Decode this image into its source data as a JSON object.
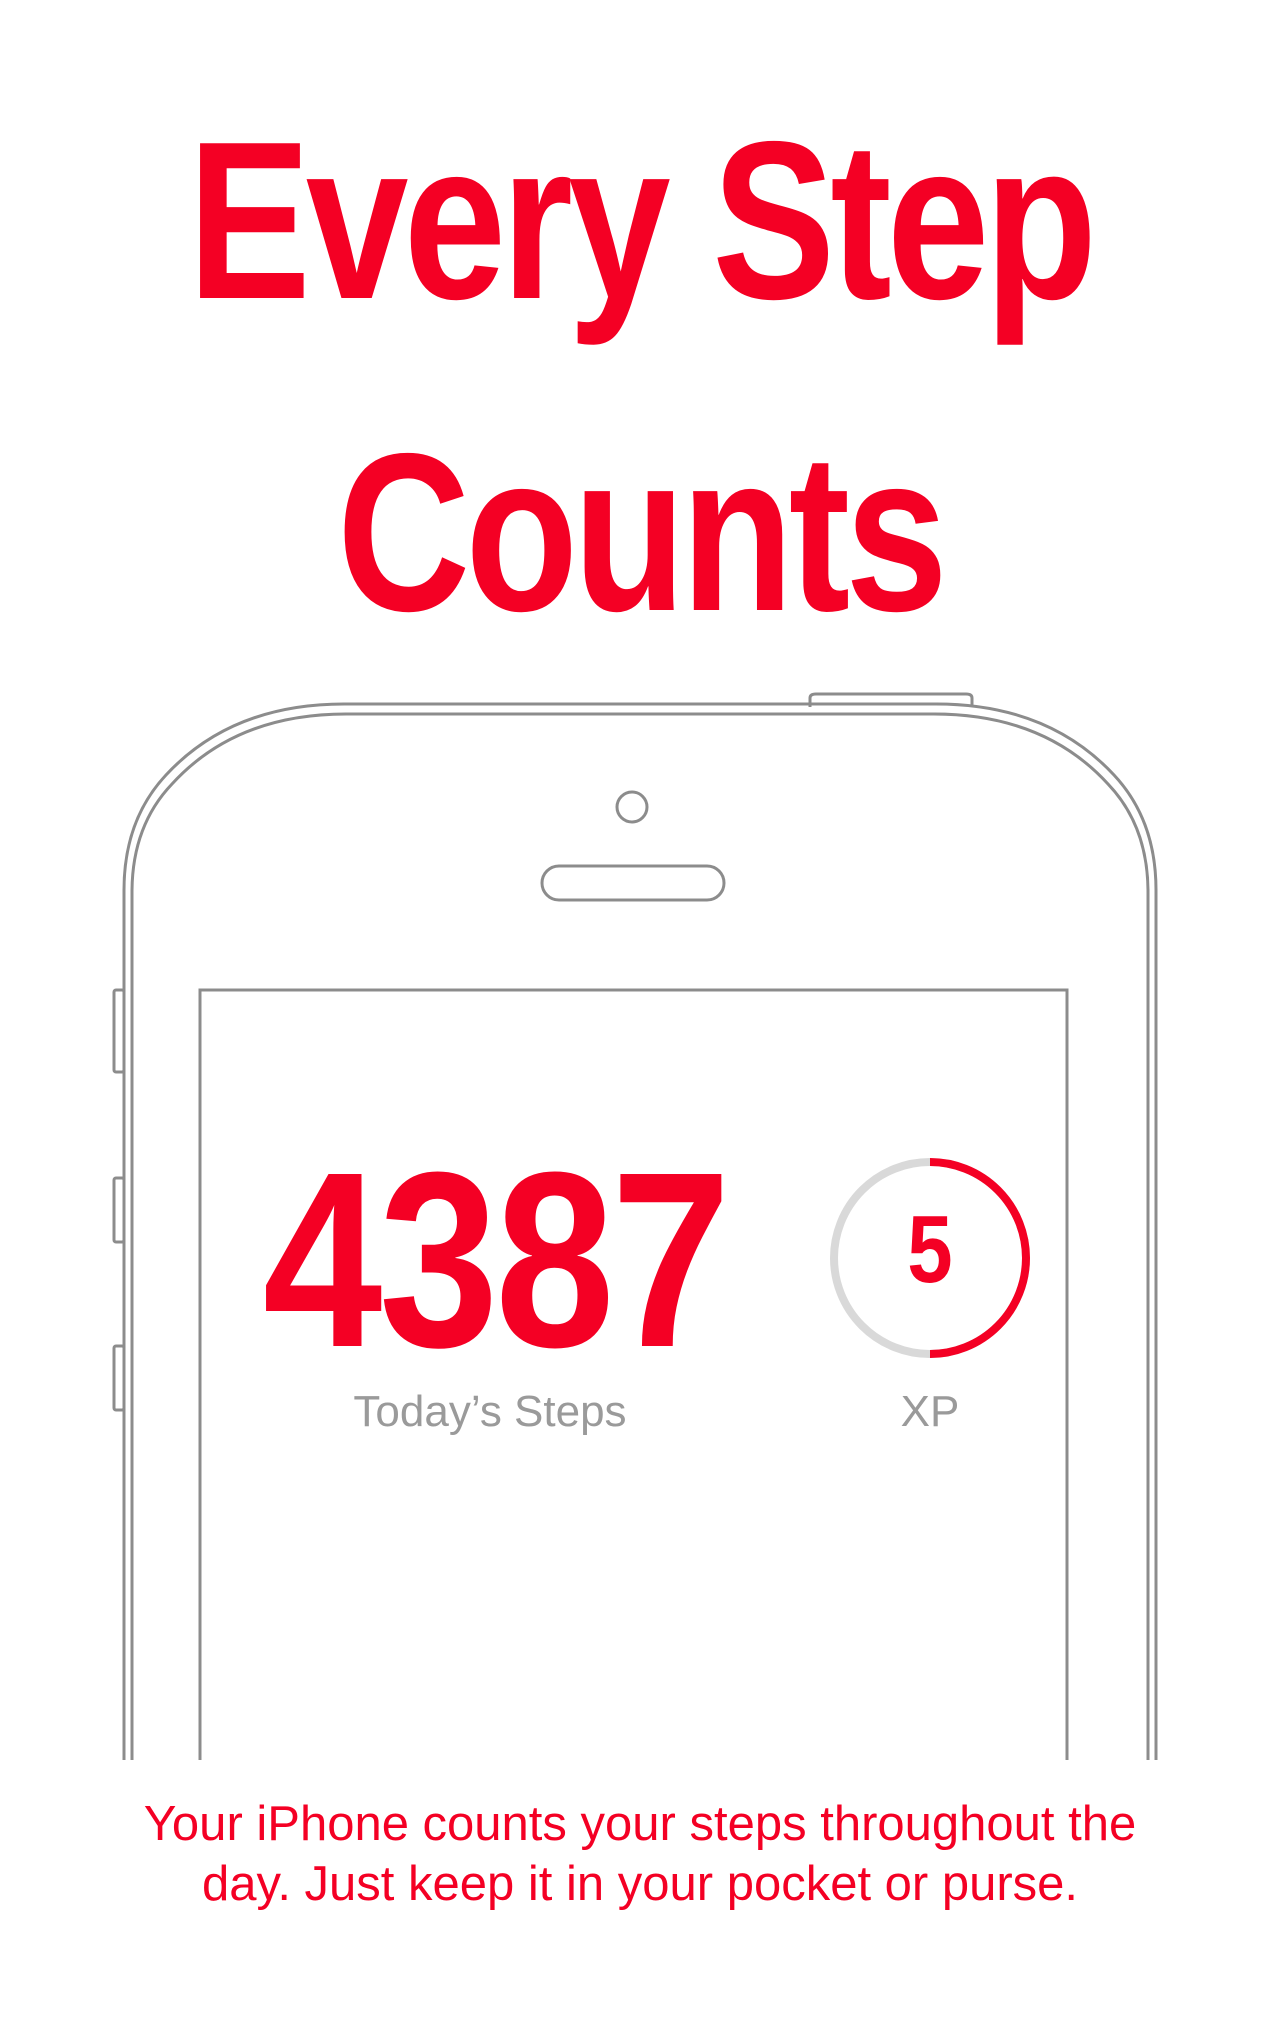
{
  "headline": {
    "line1": "Every Step",
    "line2": "Counts"
  },
  "screen": {
    "steps_value": "4387",
    "steps_label": "Today’s Steps",
    "xp_value": "5",
    "xp_label": "XP",
    "xp_progress": 0.5
  },
  "caption": {
    "line1": "Your iPhone counts your steps throughout the",
    "line2": "day.  Just keep it in your pocket or purse."
  },
  "colors": {
    "accent": "#f40024",
    "label_gray": "#9a9a9a",
    "ring_track": "#d9d9d9",
    "outline": "#8c8c8c"
  }
}
